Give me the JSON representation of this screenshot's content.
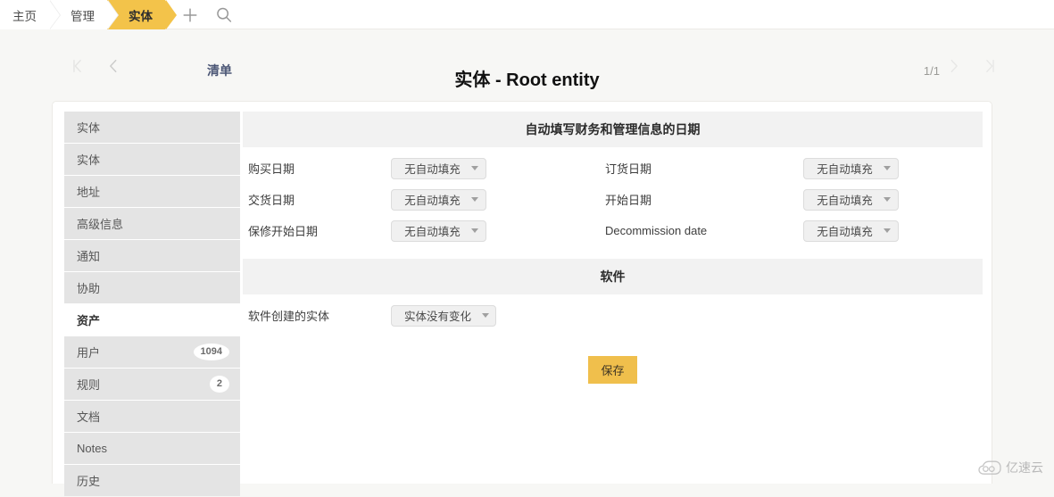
{
  "tabbar": {
    "crumbs": [
      {
        "label": "主页",
        "active": false
      },
      {
        "label": "管理",
        "active": false
      },
      {
        "label": "实体",
        "active": true
      }
    ],
    "tools": [
      {
        "name": "plus-icon"
      },
      {
        "name": "search-icon"
      }
    ]
  },
  "header": {
    "list_link": "清单",
    "title": "实体 - Root entity",
    "page_count": "1/1",
    "nav_first": "first-page-arrow",
    "nav_prev": "previous-page-arrow",
    "nav_next": "next-page-arrow",
    "nav_last": "last-page-arrow"
  },
  "sidebar": {
    "items": [
      {
        "label": "实体",
        "badge": "",
        "selected": false
      },
      {
        "label": "实体",
        "badge": "",
        "selected": false
      },
      {
        "label": "地址",
        "badge": "",
        "selected": false
      },
      {
        "label": "高级信息",
        "badge": "",
        "selected": false
      },
      {
        "label": "通知",
        "badge": "",
        "selected": false
      },
      {
        "label": "协助",
        "badge": "",
        "selected": false
      },
      {
        "label": "资产",
        "badge": "",
        "selected": true
      },
      {
        "label": "用户",
        "badge": "1094",
        "selected": false
      },
      {
        "label": "规则",
        "badge": "2",
        "selected": false
      },
      {
        "label": "文档",
        "badge": "",
        "selected": false
      },
      {
        "label": "Notes",
        "badge": "",
        "selected": false
      },
      {
        "label": "历史",
        "badge": "",
        "selected": false
      }
    ]
  },
  "main": {
    "section_dates": {
      "title": "自动填写财务和管理信息的日期",
      "rows": [
        {
          "left": {
            "label": "购买日期",
            "value": "无自动填充"
          },
          "right": {
            "label": "订货日期",
            "value": "无自动填充"
          }
        },
        {
          "left": {
            "label": "交货日期",
            "value": "无自动填充"
          },
          "right": {
            "label": "开始日期",
            "value": "无自动填充"
          }
        },
        {
          "left": {
            "label": "保修开始日期",
            "value": "无自动填充"
          },
          "right": {
            "label": "Decommission date",
            "value": "无自动填充"
          }
        }
      ]
    },
    "section_software": {
      "title": "软件",
      "rows": [
        {
          "left": {
            "label": "软件创建的实体",
            "value": "实体没有变化"
          }
        }
      ]
    },
    "save_label": "保存"
  },
  "watermark": {
    "text": "亿速云",
    "icon": "cloud-icon"
  },
  "colors": {
    "accent": "#f3c34a",
    "save_button": "#f0bf4c",
    "sidebar_item": "#e4e4e4",
    "section_header": "#f2f2f2",
    "page_background": "#f7f7f5",
    "link": "#4b5675"
  }
}
